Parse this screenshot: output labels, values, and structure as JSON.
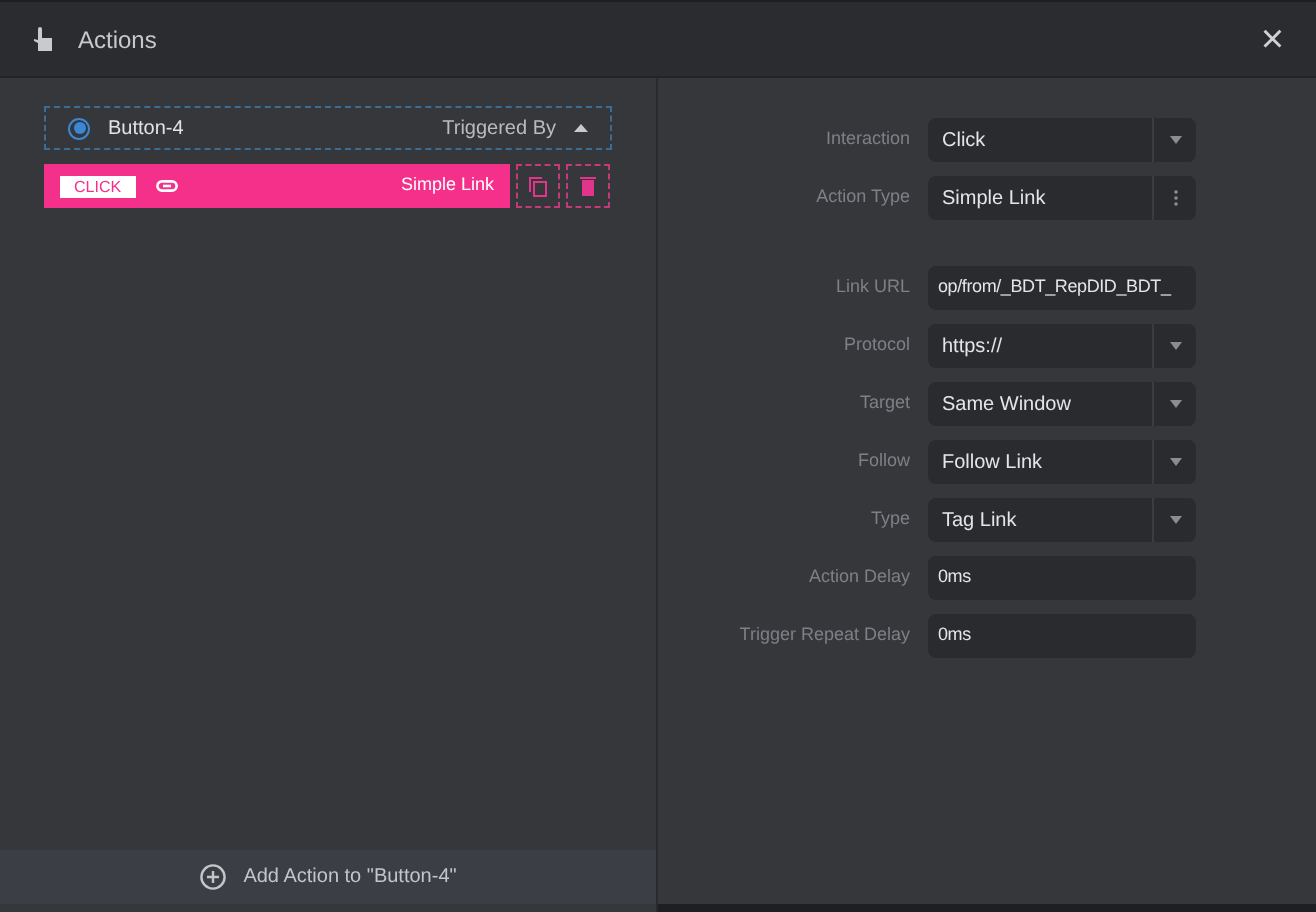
{
  "window": {
    "title": "Actions",
    "close": "×"
  },
  "trigger": {
    "name": "Button-4",
    "selected": true,
    "label": "Triggered By"
  },
  "action": {
    "event": "CLICK",
    "type": "Simple Link"
  },
  "add_action": "Add Action to \"Button-4\"",
  "field_groups": [
    [
      {
        "label": "Interaction",
        "value": "Click",
        "kind": "select"
      },
      {
        "label": "Action Type",
        "value": "Simple Link",
        "kind": "menu"
      }
    ],
    [
      {
        "label": "Link URL",
        "value": "op/from/_BDT_RepDID_BDT_",
        "kind": "input"
      },
      {
        "label": "Protocol",
        "value": "https://",
        "kind": "select"
      },
      {
        "label": "Target",
        "value": "Same Window",
        "kind": "select"
      },
      {
        "label": "Follow",
        "value": "Follow Link",
        "kind": "select"
      },
      {
        "label": "Type",
        "value": "Tag Link",
        "kind": "select"
      },
      {
        "label": "Action Delay",
        "value": "0ms",
        "kind": "input"
      },
      {
        "label": "Trigger Repeat Delay",
        "value": "0ms",
        "kind": "input"
      }
    ]
  ]
}
